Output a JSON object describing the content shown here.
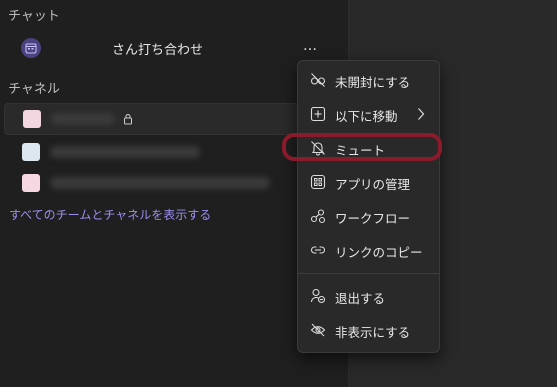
{
  "sections": {
    "chat_header": "チャット",
    "channel_header": "チャネル"
  },
  "chat": {
    "name": "さん打ち合わせ",
    "more_label": "…",
    "avatar_icon": "calendar-icon",
    "avatar_color": "#4b4380"
  },
  "channels": [
    {
      "square_color": "#f2d7e1",
      "selected": true,
      "has_lock_icon": true
    },
    {
      "square_color": "#dce7ef",
      "selected": false,
      "has_lock_icon": false
    },
    {
      "square_color": "#f6d8e2",
      "selected": false,
      "has_lock_icon": false
    }
  ],
  "show_all_link": "すべてのチームとチャネルを表示する",
  "menu": {
    "items": [
      {
        "label": "未開封にする",
        "icon": "unread-glasses-icon"
      },
      {
        "label": "以下に移動",
        "icon": "move-plus-icon",
        "has_submenu": true
      },
      {
        "label": "ミュート",
        "icon": "bell-mute-icon"
      },
      {
        "label": "アプリの管理",
        "icon": "apps-grid-icon"
      },
      {
        "label": "ワークフロー",
        "icon": "workflow-icon"
      },
      {
        "label": "リンクのコピー",
        "icon": "link-icon"
      },
      {
        "label": "退出する",
        "icon": "leave-person-icon"
      },
      {
        "label": "非表示にする",
        "icon": "hide-eye-icon"
      }
    ]
  },
  "colors": {
    "background": "#1f1f1f",
    "menu_background": "#292929",
    "link": "#9b8ff0",
    "highlight_border": "#8b1a2b"
  }
}
